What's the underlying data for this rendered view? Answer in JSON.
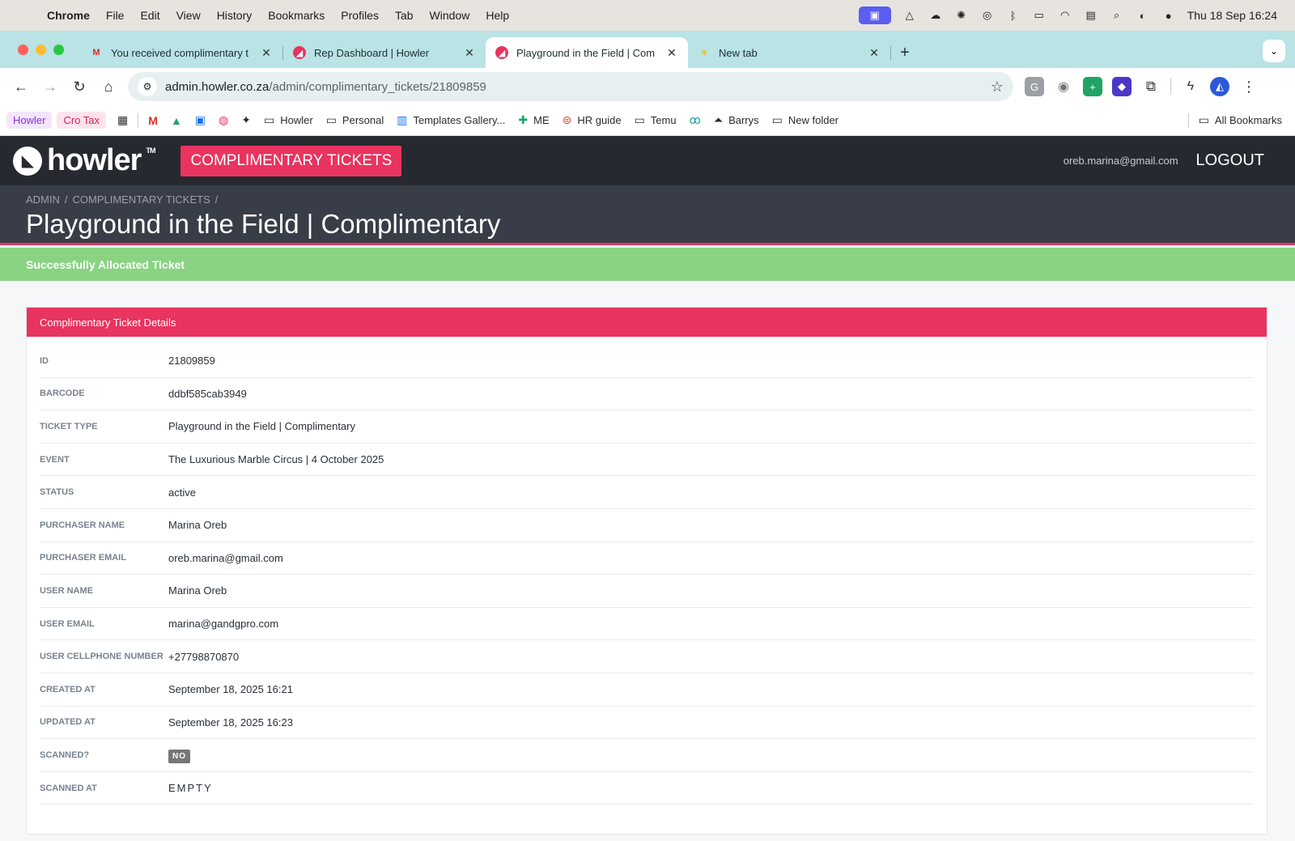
{
  "menubar": {
    "app": "Chrome",
    "items": [
      "File",
      "Edit",
      "View",
      "History",
      "Bookmarks",
      "Profiles",
      "Tab",
      "Window",
      "Help"
    ],
    "datetime": "Thu 18 Sep  16:24"
  },
  "tabs": [
    {
      "title": "You received complimentary t",
      "icon": "gmail-icon"
    },
    {
      "title": "Rep Dashboard | Howler",
      "icon": "howler-icon"
    },
    {
      "title": "Playground in the Field | Com",
      "icon": "howler-icon"
    },
    {
      "title": "New tab",
      "icon": "sun-icon"
    }
  ],
  "address": {
    "host": "admin.howler.co.za",
    "path": "/admin/complimentary_tickets/21809859"
  },
  "bookmarks": {
    "items": [
      "Howler",
      "Cro Tax",
      "Howler",
      "Personal",
      "Templates Gallery...",
      "ME",
      "HR guide",
      "Temu",
      "Barrys",
      "New folder"
    ],
    "all": "All Bookmarks"
  },
  "header": {
    "logo": "howler",
    "logo_tm": "TM",
    "nav_button": "COMPLIMENTARY TICKETS",
    "email": "oreb.marina@gmail.com",
    "logout": "LOGOUT"
  },
  "page": {
    "breadcrumb": [
      "ADMIN",
      "/",
      "COMPLIMENTARY TICKETS",
      "/"
    ],
    "title": "Playground in the Field | Complimentary"
  },
  "flash": "Successfully Allocated Ticket",
  "card": {
    "title": "Complimentary Ticket Details",
    "rows": [
      {
        "label": "ID",
        "value": "21809859"
      },
      {
        "label": "BARCODE",
        "value": "ddbf585cab3949"
      },
      {
        "label": "TICKET TYPE",
        "value": "Playground in the Field | Complimentary"
      },
      {
        "label": "EVENT",
        "value": "The Luxurious Marble Circus | 4 October 2025"
      },
      {
        "label": "STATUS",
        "value": "active"
      },
      {
        "label": "PURCHASER NAME",
        "value": "Marina Oreb"
      },
      {
        "label": "PURCHASER EMAIL",
        "value": "oreb.marina@gmail.com"
      },
      {
        "label": "USER NAME",
        "value": "Marina Oreb"
      },
      {
        "label": "USER EMAIL",
        "value": "marina@gandgpro.com"
      },
      {
        "label": "USER CELLPHONE NUMBER",
        "value": "+27798870870"
      },
      {
        "label": "CREATED AT",
        "value": "September 18, 2025 16:21"
      },
      {
        "label": "UPDATED AT",
        "value": "September 18, 2025 16:23"
      },
      {
        "label": "SCANNED?",
        "value": "NO"
      },
      {
        "label": "SCANNED AT",
        "value": "EMPTY"
      }
    ]
  },
  "colors": {
    "brand": "#e8345f",
    "header_bg": "#262a30",
    "title_bg": "#383d47",
    "success": "#89d382"
  }
}
